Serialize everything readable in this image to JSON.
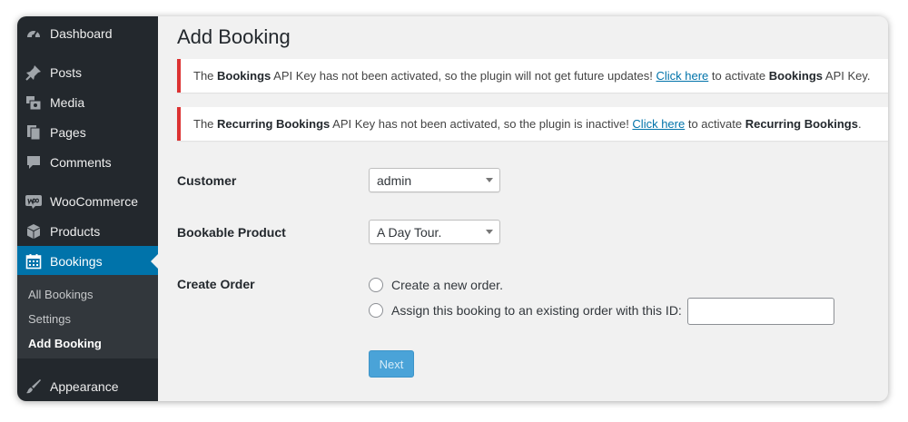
{
  "sidebar": {
    "items": [
      {
        "label": "Dashboard",
        "icon": "dashboard-icon"
      },
      {
        "label": "Posts",
        "icon": "pin-icon"
      },
      {
        "label": "Media",
        "icon": "media-icon"
      },
      {
        "label": "Pages",
        "icon": "pages-icon"
      },
      {
        "label": "Comments",
        "icon": "comment-icon"
      },
      {
        "label": "WooCommerce",
        "icon": "woocommerce-icon"
      },
      {
        "label": "Products",
        "icon": "box-icon"
      },
      {
        "label": "Bookings",
        "icon": "calendar-icon"
      },
      {
        "label": "Appearance",
        "icon": "brush-icon"
      }
    ],
    "submenu": [
      "All Bookings",
      "Settings",
      "Add Booking"
    ],
    "active_color": "#0073aa"
  },
  "page": {
    "title": "Add Booking"
  },
  "notices": [
    {
      "prefix": "The ",
      "bold1": "Bookings",
      "mid": " API Key has not been activated, so the plugin will not get future updates! ",
      "link": "Click here",
      "after": " to activate ",
      "bold2": "Bookings",
      "suffix": " API Key."
    },
    {
      "prefix": "The ",
      "bold1": "Recurring Bookings",
      "mid": " API Key has not been activated, so the plugin is inactive! ",
      "link": "Click here",
      "after": " to activate ",
      "bold2": "Recurring Bookings",
      "suffix": "."
    }
  ],
  "form": {
    "customer_label": "Customer",
    "customer_value": "admin",
    "product_label": "Bookable Product",
    "product_value": "A Day Tour.",
    "order_label": "Create Order",
    "option_new": "Create a new order.",
    "option_existing": "Assign this booking to an existing order with this ID:",
    "order_id_value": "",
    "next_label": "Next"
  },
  "colors": {
    "notice_border": "#dc3232",
    "button": "#4aa3d8"
  }
}
